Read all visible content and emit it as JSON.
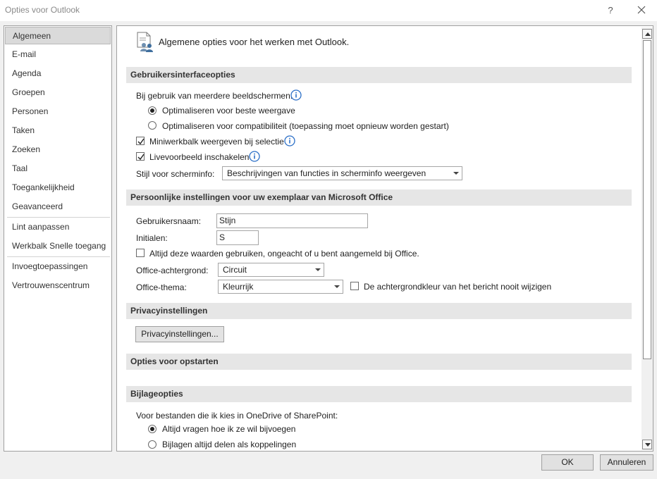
{
  "window": {
    "title": "Opties voor Outlook"
  },
  "nav": {
    "items": [
      "Algemeen",
      "E-mail",
      "Agenda",
      "Groepen",
      "Personen",
      "Taken",
      "Zoeken",
      "Taal",
      "Toegankelijkheid",
      "Geavanceerd",
      "Lint aanpassen",
      "Werkbalk Snelle toegang",
      "Invoegtoepassingen",
      "Vertrouwenscentrum"
    ],
    "selected": "Algemeen"
  },
  "header": {
    "text": "Algemene opties voor het werken met Outlook."
  },
  "ui_options": {
    "title": "Gebruikersinterfaceopties",
    "multi_screen_label": "Bij gebruik van meerdere beeldschermen:",
    "radio_best": "Optimaliseren voor beste weergave",
    "radio_compat": "Optimaliseren voor compatibiliteit (toepassing moet opnieuw worden gestart)",
    "mini_toolbar": "Miniwerkbalk weergeven bij selectie",
    "live_preview": "Livevoorbeeld inschakelen",
    "screentip_label": "Stijl voor scherminfo:",
    "screentip_value": "Beschrijvingen van functies in scherminfo weergeven"
  },
  "personal": {
    "title": "Persoonlijke instellingen voor uw exemplaar van Microsoft Office",
    "username_label": "Gebruikersnaam:",
    "username_value": "Stijn",
    "initials_label": "Initialen:",
    "initials_value": "S",
    "always_use": "Altijd deze waarden gebruiken, ongeacht of u bent aangemeld bij Office.",
    "background_label": "Office-achtergrond:",
    "background_value": "Circuit",
    "theme_label": "Office-thema:",
    "theme_value": "Kleurrijk",
    "never_change_bg": "De achtergrondkleur van het bericht nooit wijzigen"
  },
  "privacy": {
    "title": "Privacyinstellingen",
    "button": "Privacyinstellingen..."
  },
  "startup": {
    "title": "Opties voor opstarten"
  },
  "attachments": {
    "title": "Bijlageopties",
    "label": "Voor bestanden die ik kies in OneDrive of SharePoint:",
    "radio_ask": "Altijd vragen hoe ik ze wil bijvoegen",
    "radio_links": "Bijlagen altijd delen als koppelingen"
  },
  "footer": {
    "ok": "OK",
    "cancel": "Annuleren"
  },
  "icons": {
    "help": "question-mark-icon",
    "close": "close-icon",
    "info": "info-icon",
    "header": "people-options-icon"
  },
  "colors": {
    "section_bg": "#e6e6e6",
    "info_blue": "#2b6fc7",
    "selected_nav": "#dadada"
  }
}
